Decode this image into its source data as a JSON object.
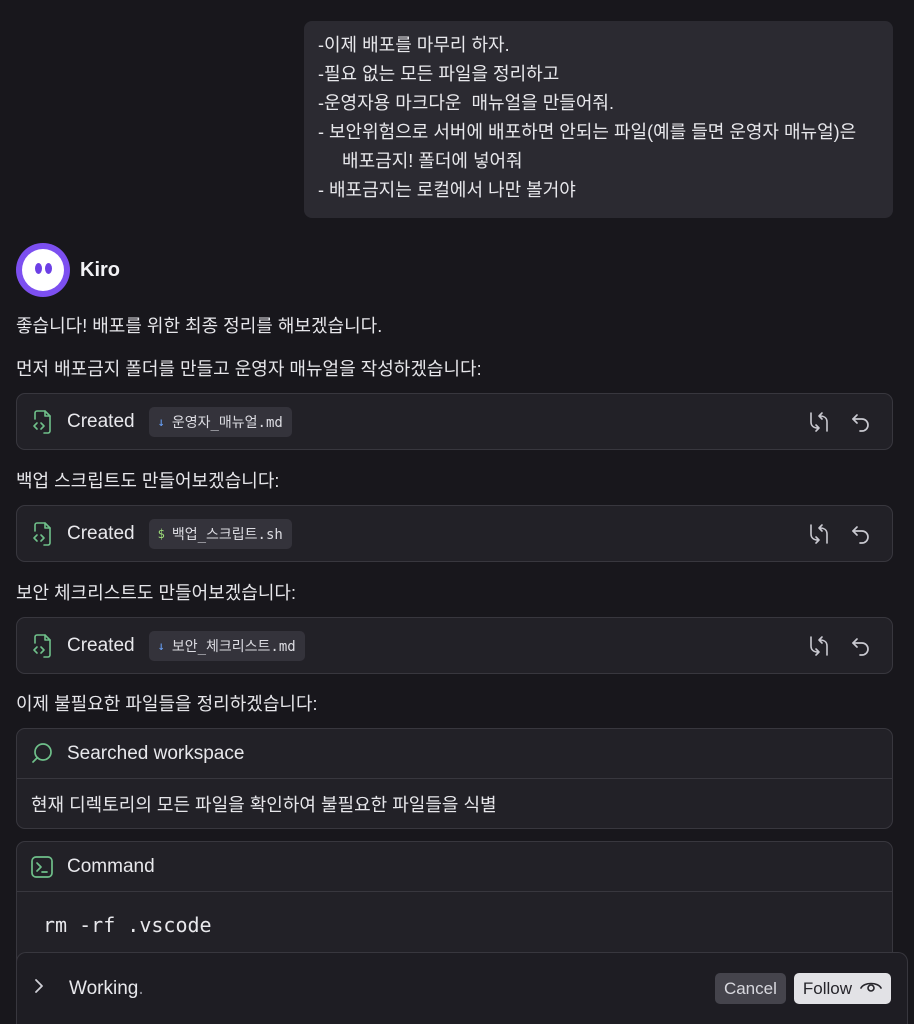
{
  "user_message": {
    "lines": [
      "-이제 배포를 마무리 하자.",
      "-필요 없는 모든 파일을 정리하고",
      "-운영자용 마크다운  매뉴얼을 만들어줘.",
      "- 보안위험으로 서버에 배포하면 안되는 파일(예를 들면 운영자 매뉴얼)은",
      "배포금지! 폴더에 넣어줘",
      "- 배포금지는 로컬에서 나만 볼거야"
    ]
  },
  "assistant": {
    "name": "Kiro"
  },
  "messages": {
    "intro": "좋습니다! 배포를 위한 최종 정리를 해보겠습니다.",
    "step1": "먼저 배포금지 폴더를 만들고 운영자 매뉴얼을 작성하겠습니다:",
    "step2": "백업 스크립트도 만들어보겠습니다:",
    "step3": "보안 체크리스트도 만들어보겠습니다:",
    "step4": "이제 불필요한 파일들을 정리하겠습니다:"
  },
  "file_cards": [
    {
      "label": "Created",
      "file": "운영자_매뉴얼.md",
      "file_icon": "markdown-icon",
      "glyph": "↓"
    },
    {
      "label": "Created",
      "file": "백업_스크립트.sh",
      "file_icon": "shell-icon",
      "glyph": "$"
    },
    {
      "label": "Created",
      "file": "보안_체크리스트.md",
      "file_icon": "markdown-icon",
      "glyph": "↓"
    }
  ],
  "search_panel": {
    "title": "Searched workspace",
    "body": "현재 디렉토리의 모든 파일을 확인하여 불필요한 파일들을 식별"
  },
  "command_panel": {
    "title": "Command",
    "command": "rm -rf .vscode"
  },
  "status_bar": {
    "working": "Working",
    "working_dot": ".",
    "cancel_label": "Cancel",
    "follow_label": "Follow"
  },
  "colors": {
    "background": "#18171c",
    "accent_purple": "#7c4ff0",
    "icon_green": "#6fc08a"
  }
}
